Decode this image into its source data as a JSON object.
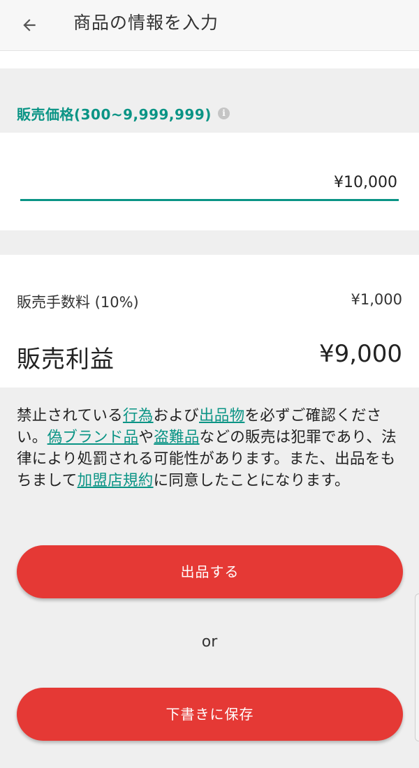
{
  "header": {
    "title": "商品の情報を入力"
  },
  "price": {
    "label": "販売価格(300~9,999,999)",
    "value": "¥10,000"
  },
  "summary": {
    "fee_label": "販売手数料 (10%)",
    "fee_value": "¥1,000",
    "profit_label": "販売利益",
    "profit_value": "¥9,000"
  },
  "notice": {
    "t1": "禁止されている",
    "link1": "行為",
    "t2": "および",
    "link2": "出品物",
    "t3": "を必ずご確認ください。",
    "link3": "偽ブランド品",
    "t4": "や",
    "link4": "盗難品",
    "t5": "などの販売は犯罪であり、法律により処罰される可能性があります。また、出品をもちまして",
    "link5": "加盟店規約",
    "t6": "に同意したことになります。"
  },
  "actions": {
    "list_label": "出品する",
    "or_label": "or",
    "draft_label": "下書きに保存"
  },
  "colors": {
    "accent": "#0a9485",
    "primary_button": "#e53935",
    "background": "#efefef"
  }
}
